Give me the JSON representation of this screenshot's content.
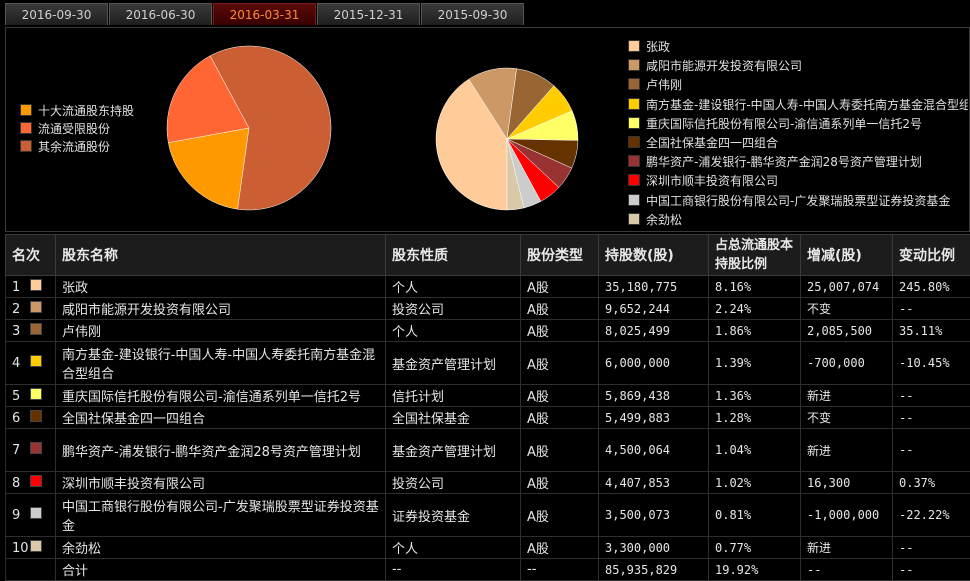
{
  "tabs": [
    "2016-09-30",
    "2016-06-30",
    "2016-03-31",
    "2015-12-31",
    "2015-09-30"
  ],
  "active_tab": 2,
  "legend_left": [
    {
      "label": "十大流通股东持股",
      "color": "#FF9900"
    },
    {
      "label": "流通受限股份",
      "color": "#FF6633"
    },
    {
      "label": "其余流通股份",
      "color": "#CC5E33"
    }
  ],
  "pie_left": [
    {
      "name": "十大流通股东持股",
      "value": 19.92,
      "color": "#FF9900"
    },
    {
      "name": "流通受限股份",
      "value": 20.0,
      "color": "#FF6633"
    },
    {
      "name": "其余流通股份",
      "value": 60.08,
      "color": "#CC5E33"
    }
  ],
  "table": {
    "headers": [
      "名次",
      "股东名称",
      "股东性质",
      "股份类型",
      "持股数(股)",
      "占总流通股本持股比例",
      "增减(股)",
      "变动比例"
    ],
    "rows": [
      {
        "rank": "1",
        "color": "#FFCC99",
        "name": "张政",
        "nature": "个人",
        "type": "A股",
        "shares": "35,180,775",
        "ratio": "8.16%",
        "change": "25,007,074",
        "pct": "245.80%",
        "value": 35180775
      },
      {
        "rank": "2",
        "color": "#CC9966",
        "name": "咸阳市能源开发投资有限公司",
        "nature": "投资公司",
        "type": "A股",
        "shares": "9,652,244",
        "ratio": "2.24%",
        "change": "不变",
        "pct": "--",
        "value": 9652244
      },
      {
        "rank": "3",
        "color": "#996633",
        "name": "卢伟刚",
        "nature": "个人",
        "type": "A股",
        "shares": "8,025,499",
        "ratio": "1.86%",
        "change": "2,085,500",
        "pct": "35.11%",
        "value": 8025499
      },
      {
        "rank": "4",
        "color": "#FFCC00",
        "name": "南方基金-建设银行-中国人寿-中国人寿委托南方基金混合型组合",
        "nature": "基金资产管理计划",
        "type": "A股",
        "shares": "6,000,000",
        "ratio": "1.39%",
        "change": "-700,000",
        "pct": "-10.45%",
        "value": 6000000
      },
      {
        "rank": "5",
        "color": "#FFFF66",
        "name": "重庆国际信托股份有限公司-渝信通系列单一信托2号",
        "nature": "信托计划",
        "type": "A股",
        "shares": "5,869,438",
        "ratio": "1.36%",
        "change": "新进",
        "pct": "--",
        "value": 5869438
      },
      {
        "rank": "6",
        "color": "#663300",
        "name": "全国社保基金四一四组合",
        "nature": "全国社保基金",
        "type": "A股",
        "shares": "5,499,883",
        "ratio": "1.28%",
        "change": "不变",
        "pct": "--",
        "value": 5499883
      },
      {
        "rank": "7",
        "color": "#993333",
        "name": "鹏华资产-浦发银行-鹏华资产金润28号资产管理计划",
        "nature": "基金资产管理计划",
        "type": "A股",
        "shares": "4,500,064",
        "ratio": "1.04%",
        "change": "新进",
        "pct": "--",
        "value": 4500064
      },
      {
        "rank": "8",
        "color": "#FF0000",
        "name": "深圳市顺丰投资有限公司",
        "nature": "投资公司",
        "type": "A股",
        "shares": "4,407,853",
        "ratio": "1.02%",
        "change": "16,300",
        "pct": "0.37%",
        "value": 4407853
      },
      {
        "rank": "9",
        "color": "#CCCCCC",
        "name": "中国工商银行股份有限公司-广发聚瑞股票型证券投资基金",
        "nature": "证券投资基金",
        "type": "A股",
        "shares": "3,500,073",
        "ratio": "0.81%",
        "change": "-1,000,000",
        "pct": "-22.22%",
        "value": 3500073
      },
      {
        "rank": "10",
        "color": "#D9C9A8",
        "name": "余劲松",
        "nature": "个人",
        "type": "A股",
        "shares": "3,300,000",
        "ratio": "0.77%",
        "change": "新进",
        "pct": "--",
        "value": 3300000
      }
    ],
    "total": {
      "label": "合计",
      "nature": "--",
      "type": "--",
      "shares": "85,935,829",
      "ratio": "19.92%",
      "change": "--",
      "pct": "--"
    }
  }
}
